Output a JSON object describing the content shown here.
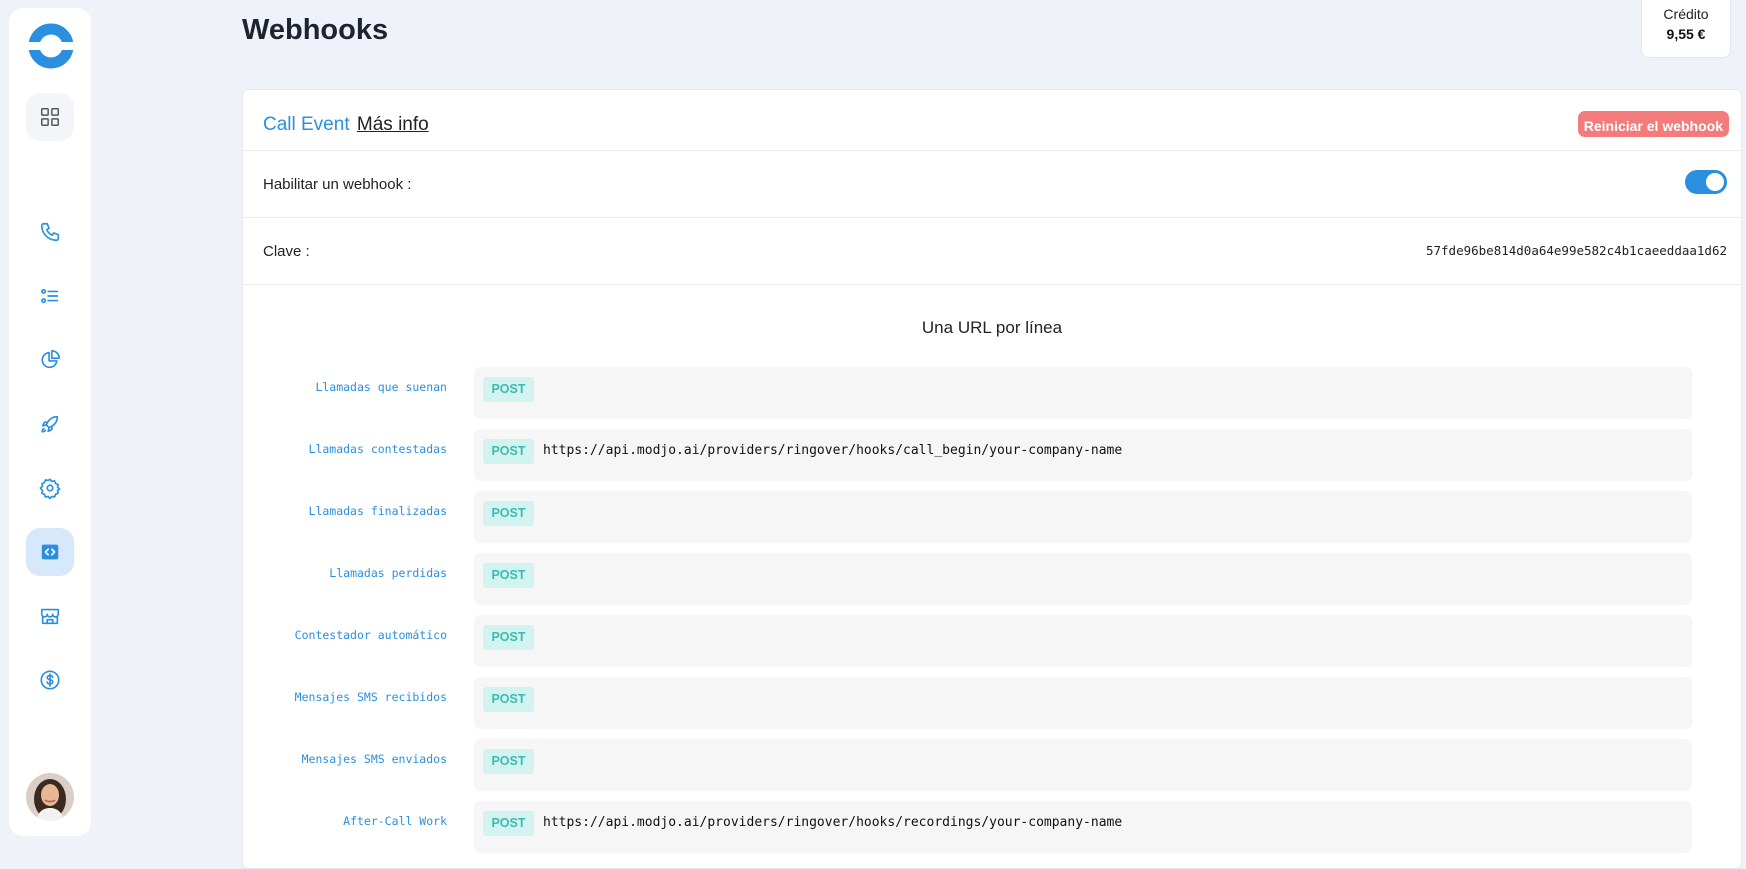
{
  "page": {
    "title": "Webhooks"
  },
  "credit": {
    "label": "Crédito",
    "value": "9,55 €"
  },
  "colors": {
    "accent": "#2b8fe0",
    "danger": "#f37b7b",
    "post_badge_bg": "#d2f3f0",
    "post_badge_text": "#3cbcb0"
  },
  "sidebar": {
    "items": [
      {
        "name": "dashboard",
        "icon": "grid-icon"
      },
      {
        "name": "calls",
        "icon": "phone-icon"
      },
      {
        "name": "lists",
        "icon": "list-icon"
      },
      {
        "name": "statistics",
        "icon": "pie-chart-icon"
      },
      {
        "name": "launch",
        "icon": "rocket-icon"
      },
      {
        "name": "settings",
        "icon": "gear-icon"
      },
      {
        "name": "developer",
        "icon": "code-icon",
        "active": true
      },
      {
        "name": "store",
        "icon": "store-icon"
      },
      {
        "name": "billing",
        "icon": "dollar-icon"
      }
    ]
  },
  "card": {
    "title_event": "Call Event",
    "title_more": "Más info",
    "reset_button": "Reiniciar el webhook",
    "enable_label": "Habilitar un webhook :",
    "enabled": true,
    "key_label": "Clave :",
    "key_value": "57fde96be814d0a64e99e582c4b1caeeddaa1d62",
    "hint": "Una URL por línea",
    "method": "POST",
    "hooks": [
      {
        "label": "Llamadas que suenan",
        "url": ""
      },
      {
        "label": "Llamadas contestadas",
        "url": "https://api.modjo.ai/providers/ringover/hooks/call_begin/your-company-name"
      },
      {
        "label": "Llamadas finalizadas",
        "url": ""
      },
      {
        "label": "Llamadas perdidas",
        "url": ""
      },
      {
        "label": "Contestador automático",
        "url": ""
      },
      {
        "label": "Mensajes SMS recibidos",
        "url": ""
      },
      {
        "label": "Mensajes SMS enviados",
        "url": ""
      },
      {
        "label": "After-Call Work",
        "url": "https://api.modjo.ai/providers/ringover/hooks/recordings/your-company-name"
      }
    ]
  }
}
